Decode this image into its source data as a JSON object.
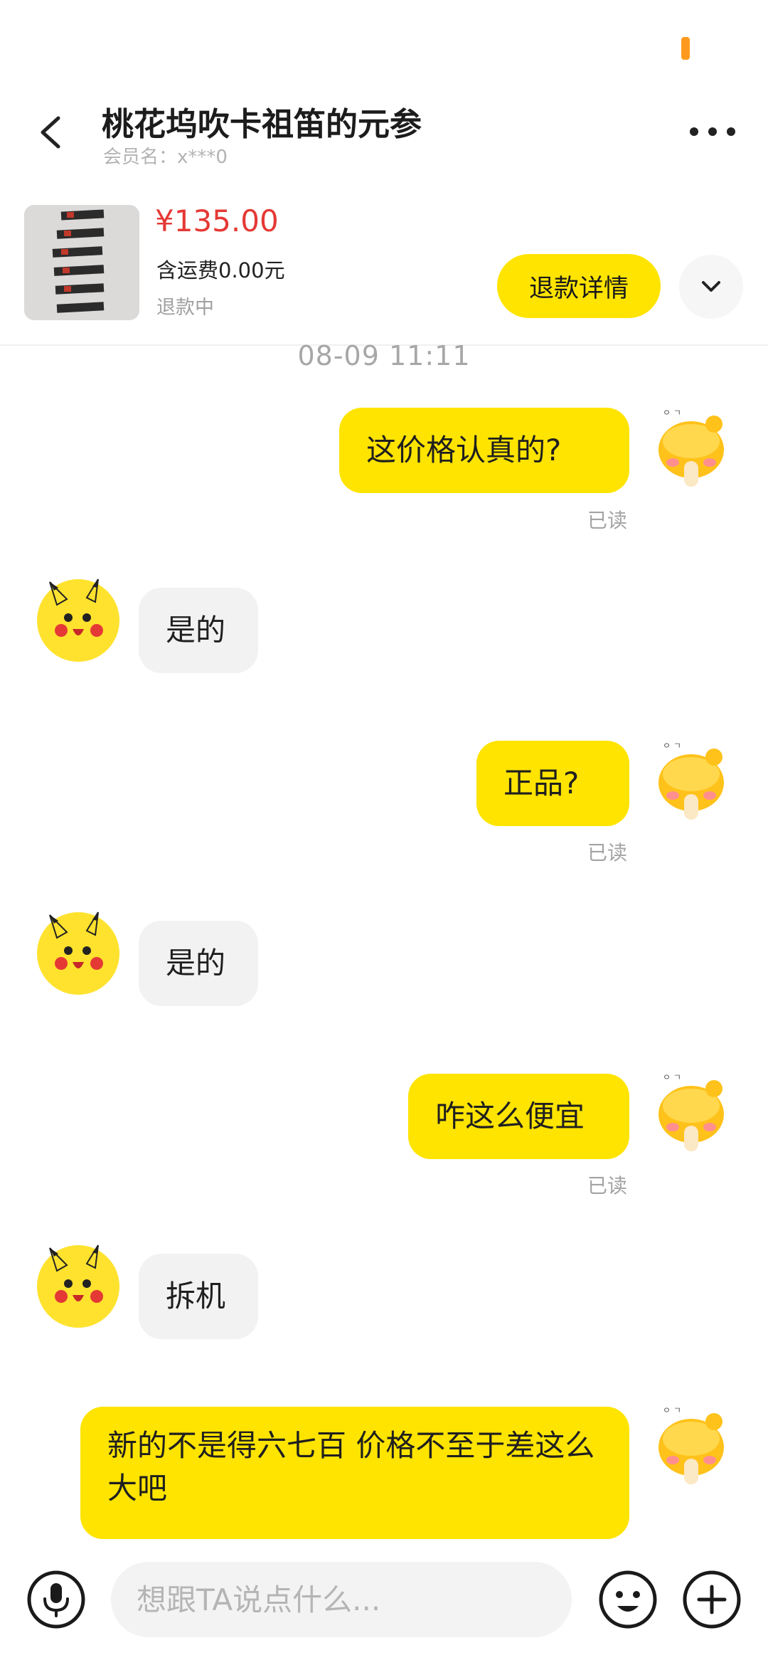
{
  "header": {
    "title": "桃花坞吹卡祖笛的元参",
    "member_label": "会员名：x***0"
  },
  "product": {
    "price": "¥135.00",
    "shipping": "含运费0.00元",
    "status": "退款中",
    "refund_button": "退款详情"
  },
  "chat": {
    "timestamp": "08-09 11:11",
    "messages": [
      {
        "from": "me",
        "text": "这价格认真的?",
        "status": "已读"
      },
      {
        "from": "them",
        "text": "是的"
      },
      {
        "from": "me",
        "text": "正品?",
        "status": "已读"
      },
      {
        "from": "them",
        "text": "是的"
      },
      {
        "from": "me",
        "text": "咋这么便宜",
        "status": "已读"
      },
      {
        "from": "them",
        "text": "拆机"
      },
      {
        "from": "me",
        "text": "新的不是得六七百  价格不至于差这么大吧"
      }
    ]
  },
  "composer": {
    "placeholder": "想跟TA说点什么..."
  },
  "colors": {
    "accent": "#ffe400",
    "price": "#e53935"
  }
}
